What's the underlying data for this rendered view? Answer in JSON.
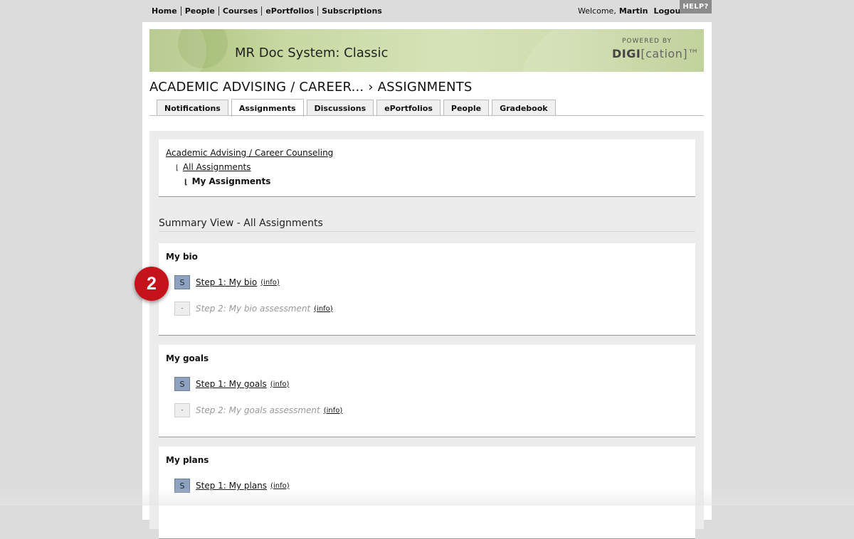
{
  "topnav": {
    "items": [
      "Home",
      "People",
      "Courses",
      "ePortfolios",
      "Subscriptions"
    ],
    "welcome_prefix": "Welcome,",
    "user_name": "Martin",
    "logout_label": "Logout",
    "help_label": "HELP?"
  },
  "banner": {
    "title": "MR Doc System: Classic",
    "powered_by": "POWERED BY",
    "brand_bold": "DIGI",
    "brand_light": "[cation]™"
  },
  "course": {
    "heading": "ACADEMIC ADVISING / CAREER... › ASSIGNMENTS"
  },
  "tabs": [
    {
      "label": "Notifications",
      "active": false
    },
    {
      "label": "Assignments",
      "active": true
    },
    {
      "label": "Discussions",
      "active": false
    },
    {
      "label": "ePortfolios",
      "active": false
    },
    {
      "label": "People",
      "active": false
    },
    {
      "label": "Gradebook",
      "active": false
    }
  ],
  "breadcrumb": {
    "root": "Academic Advising / Career Counseling",
    "level2": "All Assignments",
    "level3": "My Assignments"
  },
  "summary": {
    "title": "Summary View - All Assignments"
  },
  "groups": [
    {
      "title": "My bio",
      "steps": [
        {
          "badge": "S",
          "label": "Step 1: My bio",
          "info": "(info)",
          "enabled": true
        },
        {
          "badge": "-",
          "label": "Step 2: My bio assessment",
          "info": "(info)",
          "enabled": false
        }
      ]
    },
    {
      "title": "My goals",
      "steps": [
        {
          "badge": "S",
          "label": "Step 1: My goals",
          "info": "(info)",
          "enabled": true
        },
        {
          "badge": "-",
          "label": "Step 2: My goals assessment",
          "info": "(info)",
          "enabled": false
        }
      ]
    },
    {
      "title": "My plans",
      "steps": [
        {
          "badge": "S",
          "label": "Step 1: My plans",
          "info": "(info)",
          "enabled": true
        }
      ]
    }
  ],
  "annotation": {
    "marker_number": "2"
  },
  "colors": {
    "step_badge": "#8ea1bf",
    "marker": "#c4131b",
    "help_button": "#8b8b8b"
  }
}
